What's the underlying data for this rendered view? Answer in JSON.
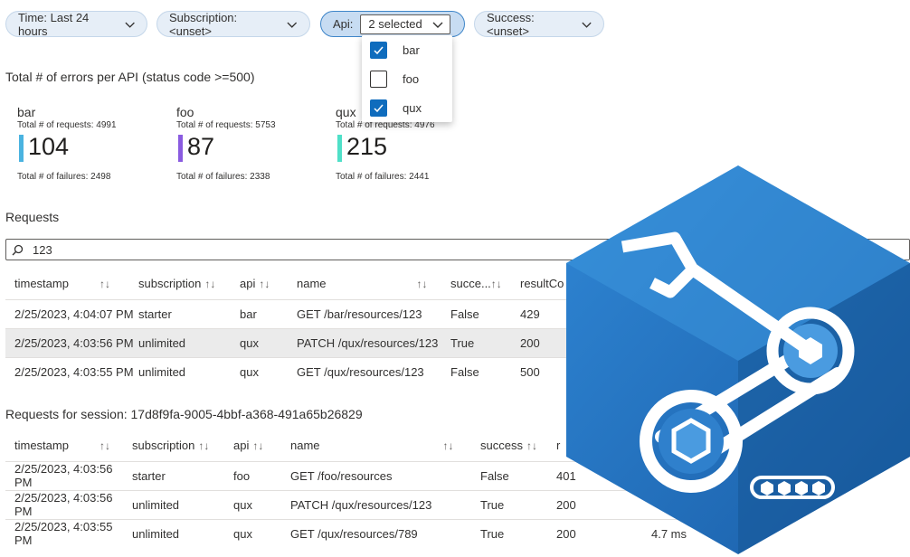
{
  "filters": {
    "time": "Time: Last 24 hours",
    "subscription": "Subscription: <unset>",
    "api_label": "Api:",
    "api_value": "2 selected",
    "success": "Success: <unset>"
  },
  "api_options": [
    {
      "label": "bar",
      "checked": true
    },
    {
      "label": "foo",
      "checked": false
    },
    {
      "label": "qux",
      "checked": true
    }
  ],
  "errors_title": "Total # of errors per API (status code >=500)",
  "tiles": [
    {
      "name": "bar",
      "requests": "Total # of requests: 4991",
      "value": "104",
      "failures": "Total # of failures: 2498",
      "color": "#4ab3e0"
    },
    {
      "name": "foo",
      "requests": "Total # of requests: 5753",
      "value": "87",
      "failures": "Total # of failures: 2338",
      "color": "#8a5be0"
    },
    {
      "name": "qux",
      "requests": "Total # of requests: 4976",
      "value": "215",
      "failures": "Total # of failures: 2441",
      "color": "#4fe0c8"
    }
  ],
  "requests_title": "Requests",
  "search_value": "123",
  "requests_table": {
    "headers": [
      "timestamp",
      "subscription",
      "api",
      "name",
      "succe...",
      "resultCo"
    ],
    "rows": [
      [
        "2/25/2023, 4:04:07 PM",
        "starter",
        "bar",
        "GET /bar/resources/123",
        "False",
        "429"
      ],
      [
        "2/25/2023, 4:03:56 PM",
        "unlimited",
        "qux",
        "PATCH /qux/resources/123",
        "True",
        "200"
      ],
      [
        "2/25/2023, 4:03:55 PM",
        "unlimited",
        "qux",
        "GET /qux/resources/123",
        "False",
        "500"
      ]
    ]
  },
  "session_title": "Requests for session: 17d8f9fa-9005-4bbf-a368-491a65b26829",
  "session_table": {
    "headers": [
      "timestamp",
      "subscription",
      "api",
      "name",
      "success",
      "r"
    ],
    "rows": [
      [
        "2/25/2023, 4:03:56 PM",
        "starter",
        "foo",
        "GET /foo/resources",
        "False",
        "401",
        ""
      ],
      [
        "2/25/2023, 4:03:56 PM",
        "unlimited",
        "qux",
        "PATCH /qux/resources/123",
        "True",
        "200",
        ""
      ],
      [
        "2/25/2023, 4:03:55 PM",
        "unlimited",
        "qux",
        "GET /qux/resources/789",
        "True",
        "200",
        "4.7 ms"
      ]
    ]
  },
  "colors": {
    "accent": "#0f6cbd",
    "logo_blue": "#1b6fc0"
  }
}
